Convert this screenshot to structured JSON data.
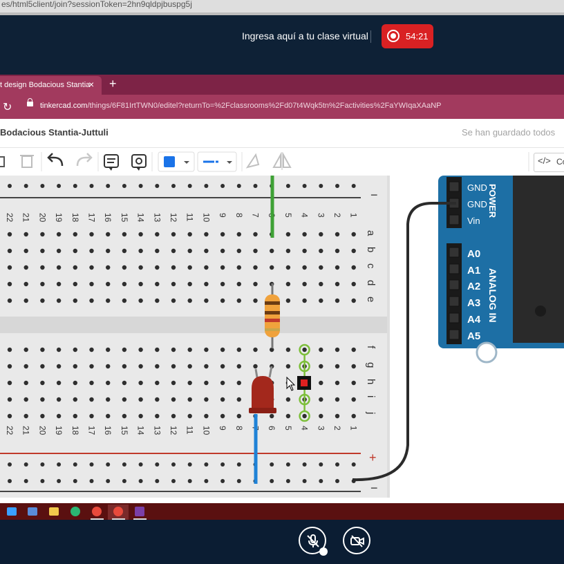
{
  "outer_browser": {
    "url_fragment": "es/html5client/join?sessionToken=2hn9qldpjbuspg5j"
  },
  "meeting": {
    "title": "Ingresa aquí a tu clase virtual",
    "recording_time": "54:21"
  },
  "browser": {
    "tab_title": "t design Bodacious Stantia",
    "tab_close": "×",
    "new_tab": "+",
    "url_domain": "tinkercad.com",
    "url_path": "/things/6F81IrtTWN0/editel?returnTo=%2Fclassrooms%2Fd07t4Wqk5tn%2Factivities%2FaYWIqaXAaNP"
  },
  "tinkercad": {
    "project_title": "Bodacious Stantia-Juttuli",
    "save_status": "Se han guardado todos",
    "code_button": "Có"
  },
  "breadboard": {
    "columns_top": [
      "22",
      "21",
      "20",
      "19",
      "18",
      "17",
      "16",
      "15",
      "14",
      "13",
      "12",
      "11",
      "10",
      "9",
      "8",
      "7",
      "6",
      "5",
      "4",
      "3",
      "2",
      "1"
    ],
    "rows_top": [
      "a",
      "b",
      "c",
      "d",
      "e"
    ],
    "rows_bottom": [
      "f",
      "g",
      "h",
      "i",
      "j"
    ],
    "minus_sign": "−",
    "plus_sign": "+"
  },
  "arduino": {
    "power_pins": [
      "GND",
      "GND",
      "Vin"
    ],
    "power_label": "POWER",
    "analog_pins": [
      "A0",
      "A1",
      "A2",
      "A3",
      "A4",
      "A5"
    ],
    "analog_label": "ANALOG IN"
  },
  "colors": {
    "tinkercad_accent": "#a23a5e",
    "arduino_blue": "#1d6fa5",
    "record_red": "#d92123"
  }
}
